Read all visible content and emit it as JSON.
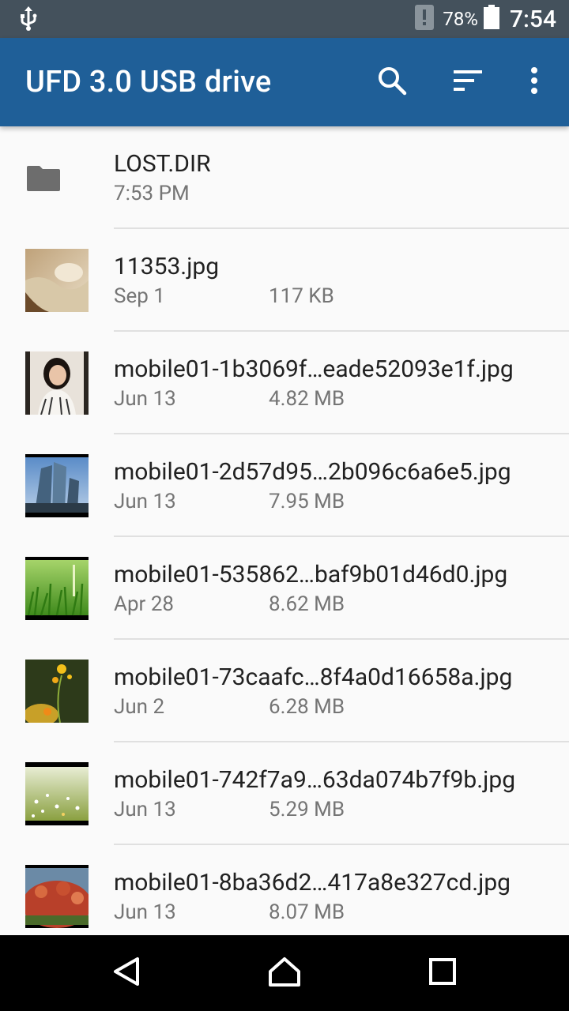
{
  "status_bar": {
    "usb_icon": "usb-icon",
    "battery_percent": "78%",
    "battery_level": 0.78,
    "time": "7:54"
  },
  "app_bar": {
    "title": "UFD 3.0 USB drive",
    "color": "#1f5f98",
    "actions": [
      "search-icon",
      "sort-icon",
      "more-vert-icon"
    ]
  },
  "files": [
    {
      "name": "LOST.DIR",
      "date": "7:53 PM",
      "size": "",
      "kind": "folder"
    },
    {
      "name": "11353.jpg",
      "date": "Sep 1",
      "size": "117 KB",
      "kind": "image"
    },
    {
      "name": "mobile01-1b3069f…eade52093e1f.jpg",
      "date": "Jun 13",
      "size": "4.82 MB",
      "kind": "image"
    },
    {
      "name": "mobile01-2d57d95…2b096c6a6e5.jpg",
      "date": "Jun 13",
      "size": "7.95 MB",
      "kind": "image"
    },
    {
      "name": "mobile01-535862…baf9b01d46d0.jpg",
      "date": "Apr 28",
      "size": "8.62 MB",
      "kind": "image"
    },
    {
      "name": "mobile01-73caafc…8f4a0d16658a.jpg",
      "date": "Jun 2",
      "size": "6.28 MB",
      "kind": "image"
    },
    {
      "name": "mobile01-742f7a9…63da074b7f9b.jpg",
      "date": "Jun 13",
      "size": "5.29 MB",
      "kind": "image"
    },
    {
      "name": "mobile01-8ba36d2…417a8e327cd.jpg",
      "date": "Jun 13",
      "size": "8.07 MB",
      "kind": "image"
    }
  ],
  "nav_bar": [
    "back-icon",
    "home-icon",
    "recents-icon"
  ]
}
